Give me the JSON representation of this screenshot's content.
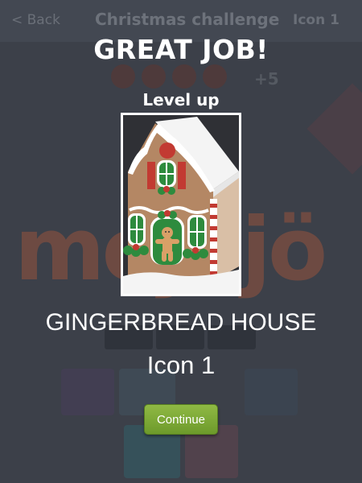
{
  "background": {
    "back_label": "< Back",
    "title": "Christmas challenge",
    "level": "Icon 1",
    "bonus": "+5",
    "watermark": "mojojö"
  },
  "modal": {
    "headline": "GREAT JOB!",
    "subheadline": "Level up",
    "item_name": "GINGERBREAD HOUSE",
    "item_level": "Icon 1",
    "continue_label": "Continue"
  },
  "colors": {
    "button": "#7aa636",
    "overlay": "#3c4049"
  },
  "icons": {
    "reward_image": "gingerbread-house-icon"
  }
}
